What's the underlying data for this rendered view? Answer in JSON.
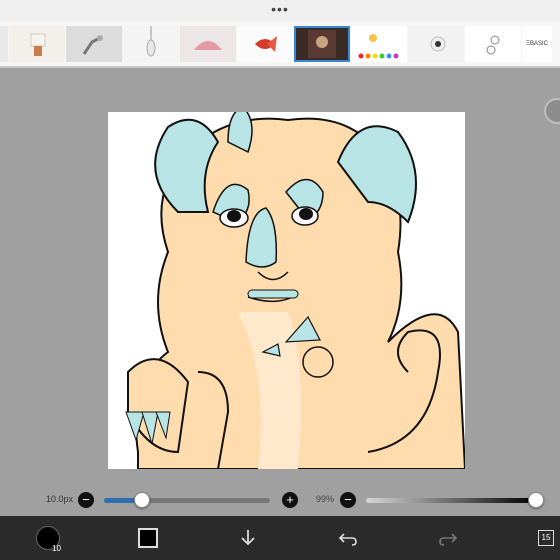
{
  "header": {
    "more_menu": "•••"
  },
  "thumbnails": [
    {
      "name": "lamp",
      "selected": false
    },
    {
      "name": "table-lamp",
      "selected": false
    },
    {
      "name": "robot-arm",
      "selected": false
    },
    {
      "name": "pendant-light",
      "selected": false
    },
    {
      "name": "pink-shade",
      "selected": false
    },
    {
      "name": "red-fish",
      "selected": false
    },
    {
      "name": "canvas-drawing",
      "selected": true
    },
    {
      "name": "palette",
      "selected": false
    },
    {
      "name": "bulb",
      "selected": false
    },
    {
      "name": "sketch",
      "selected": false
    },
    {
      "name": "text-logo",
      "selected": false,
      "text": "ΞBASIC"
    }
  ],
  "brush": {
    "size_label": "10.0px",
    "size_value": 10,
    "opacity_label": "99%"
  },
  "toolbar": {
    "brush_size_badge": "10",
    "layer_count": "15"
  },
  "colors": {
    "accent": "#3a86d6",
    "fur": "#ffdcae",
    "fur_light": "#ffe9cc",
    "horn": "#b8e4e6",
    "primary": "#000000"
  }
}
